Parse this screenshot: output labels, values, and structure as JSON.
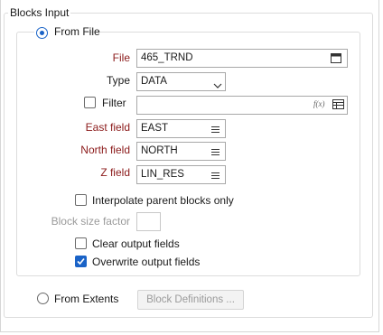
{
  "group_title": "Blocks Input",
  "from_file": {
    "label": "From File",
    "selected": true,
    "file_label": "File",
    "file_value": "465_TRND",
    "type_label": "Type",
    "type_value": "DATA",
    "filter_label": "Filter",
    "filter_checked": false,
    "filter_value": "",
    "filter_fx": "f(x)",
    "east_label": "East field",
    "east_value": "EAST",
    "north_label": "North field",
    "north_value": "NORTH",
    "z_label": "Z field",
    "z_value": "LIN_RES",
    "interpolate_label": "Interpolate parent blocks only",
    "interpolate_checked": false,
    "block_size_label": "Block size factor",
    "block_size_value": "",
    "clear_label": "Clear output fields",
    "clear_checked": false,
    "overwrite_label": "Overwrite output fields",
    "overwrite_checked": true
  },
  "from_extents": {
    "label": "From Extents",
    "selected": false,
    "block_defs_label": "Block Definitions ..."
  },
  "colors": {
    "accent": "#1a63c7",
    "required_label": "#8b1a1a",
    "disabled_text": "#9a9a9a"
  }
}
